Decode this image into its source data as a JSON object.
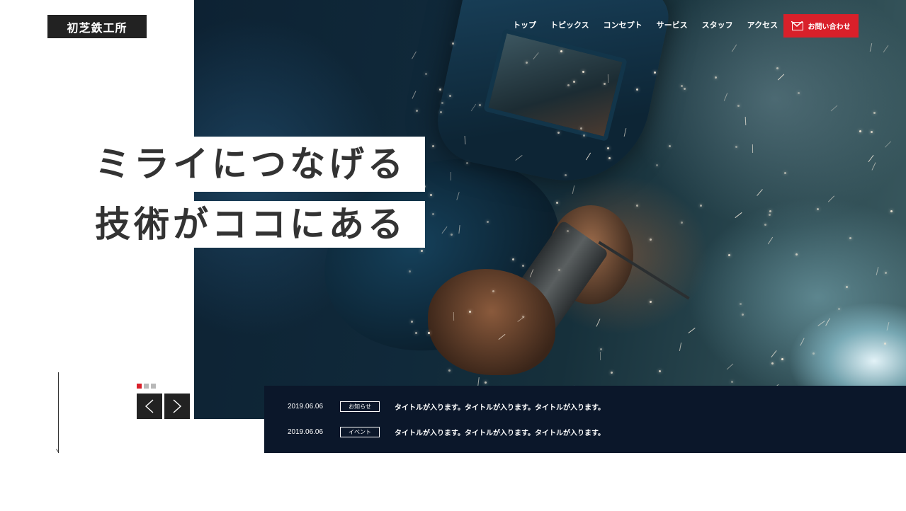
{
  "header": {
    "logo_text": "初芝鉄工所",
    "nav": [
      "トップ",
      "トピックス",
      "コンセプト",
      "サービス",
      "スタッフ",
      "アクセス"
    ],
    "contact_label": "お問い合わせ",
    "contact_icon": "mail-icon"
  },
  "hero": {
    "headline_line1": "ミライにつなげる",
    "headline_line2": "技術がココにある",
    "image": "welder-with-sparks"
  },
  "slider": {
    "slide_count": 3,
    "active_index": 0,
    "prev_label": "<",
    "next_label": ">"
  },
  "news": [
    {
      "date": "2019.06.06",
      "tag": "お知らせ",
      "title": "タイトルが入ります。タイトルが入ります。タイトルが入ります。"
    },
    {
      "date": "2019.06.06",
      "tag": "イベント",
      "title": "タイトルが入ります。タイトルが入ります。タイトルが入ります。"
    }
  ],
  "colors": {
    "accent": "#d9202a",
    "dark": "#222222",
    "news_bg": "#0b172a",
    "headline_text": "#333333"
  }
}
